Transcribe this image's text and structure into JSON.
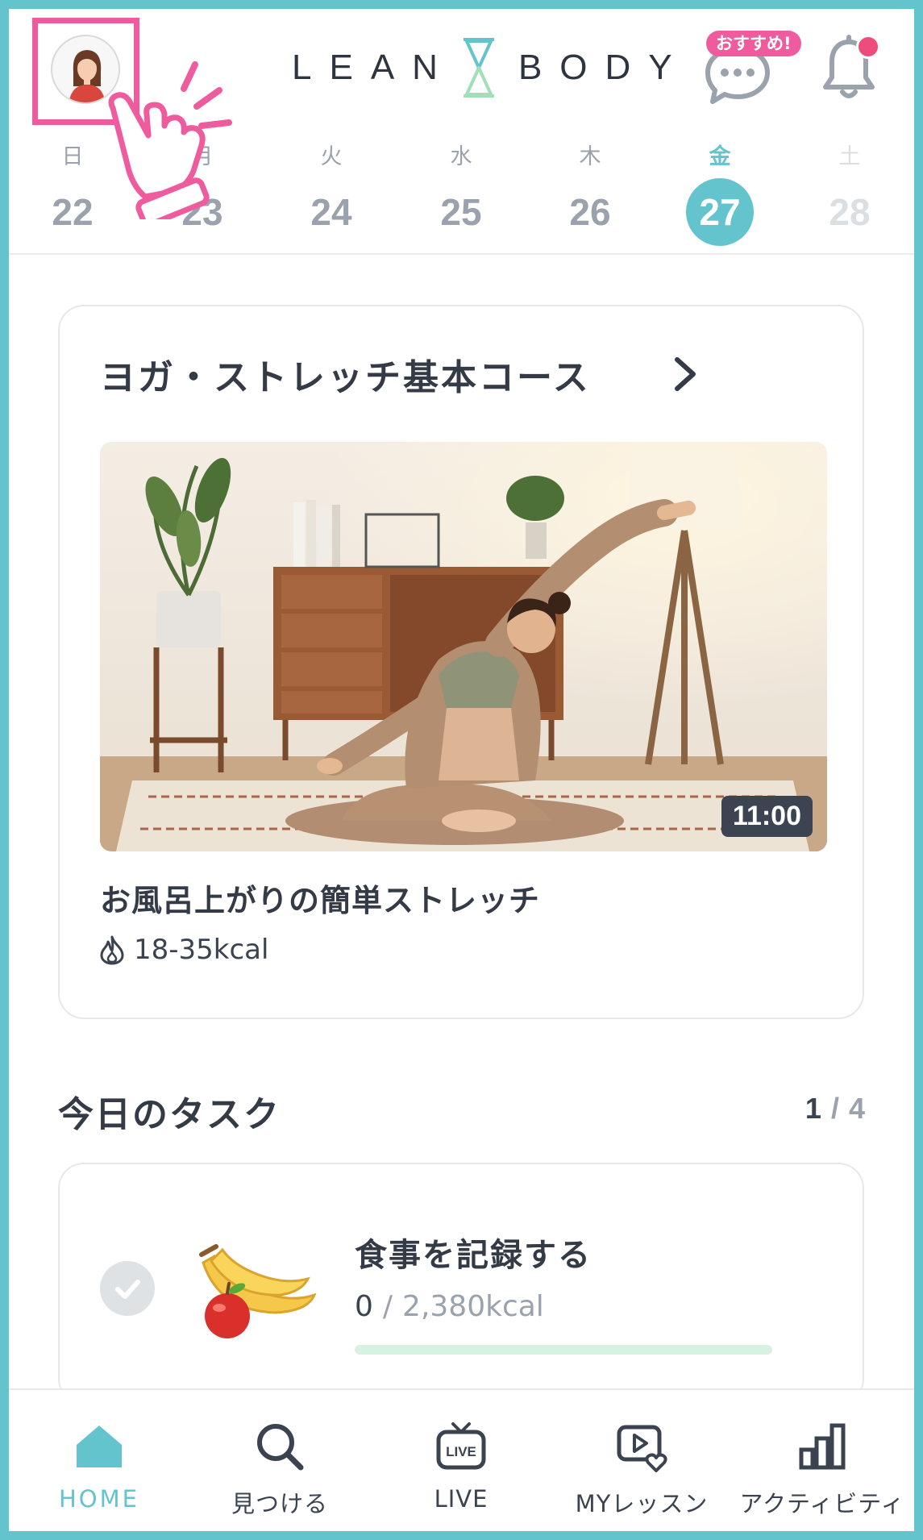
{
  "app": {
    "brand_left": "LEAN",
    "brand_right": "BODY"
  },
  "header": {
    "recommend_badge": "おすすめ!",
    "icons": [
      "avatar",
      "hourglass-logo-icon",
      "chat-bubble-icon",
      "bell-icon",
      "pointing-hand-icon"
    ]
  },
  "calendar": {
    "days": [
      {
        "dow": "日",
        "num": "22",
        "state": "past"
      },
      {
        "dow": "月",
        "num": "23",
        "state": "past"
      },
      {
        "dow": "火",
        "num": "24",
        "state": "past"
      },
      {
        "dow": "水",
        "num": "25",
        "state": "past"
      },
      {
        "dow": "木",
        "num": "26",
        "state": "past"
      },
      {
        "dow": "金",
        "num": "27",
        "state": "today"
      },
      {
        "dow": "土",
        "num": "28",
        "state": "future"
      }
    ]
  },
  "course": {
    "title": "ヨガ・ストレッチ基本コース",
    "lesson_title": "お風呂上がりの簡単ストレッチ",
    "duration": "11:00",
    "kcal": "18-35kcal"
  },
  "tasks": {
    "title": "今日のタスク",
    "done": "1",
    "total": "4",
    "items": [
      {
        "label": "食事を記録する",
        "current": "0",
        "target": "2,380kcal",
        "progress": 0
      }
    ]
  },
  "nav": {
    "items": [
      {
        "label": "HOME",
        "icon": "home-icon",
        "active": true
      },
      {
        "label": "見つける",
        "icon": "search-icon",
        "active": false
      },
      {
        "label": "LIVE",
        "icon": "live-tv-icon",
        "active": false
      },
      {
        "label": "MYレッスン",
        "icon": "play-heart-icon",
        "active": false
      },
      {
        "label": "アクティビティ",
        "icon": "bar-chart-icon",
        "active": false
      }
    ]
  },
  "colors": {
    "accent": "#63c4cd",
    "pink": "#ee5c9e",
    "text": "#3b4350",
    "muted": "#9aa2ad"
  }
}
